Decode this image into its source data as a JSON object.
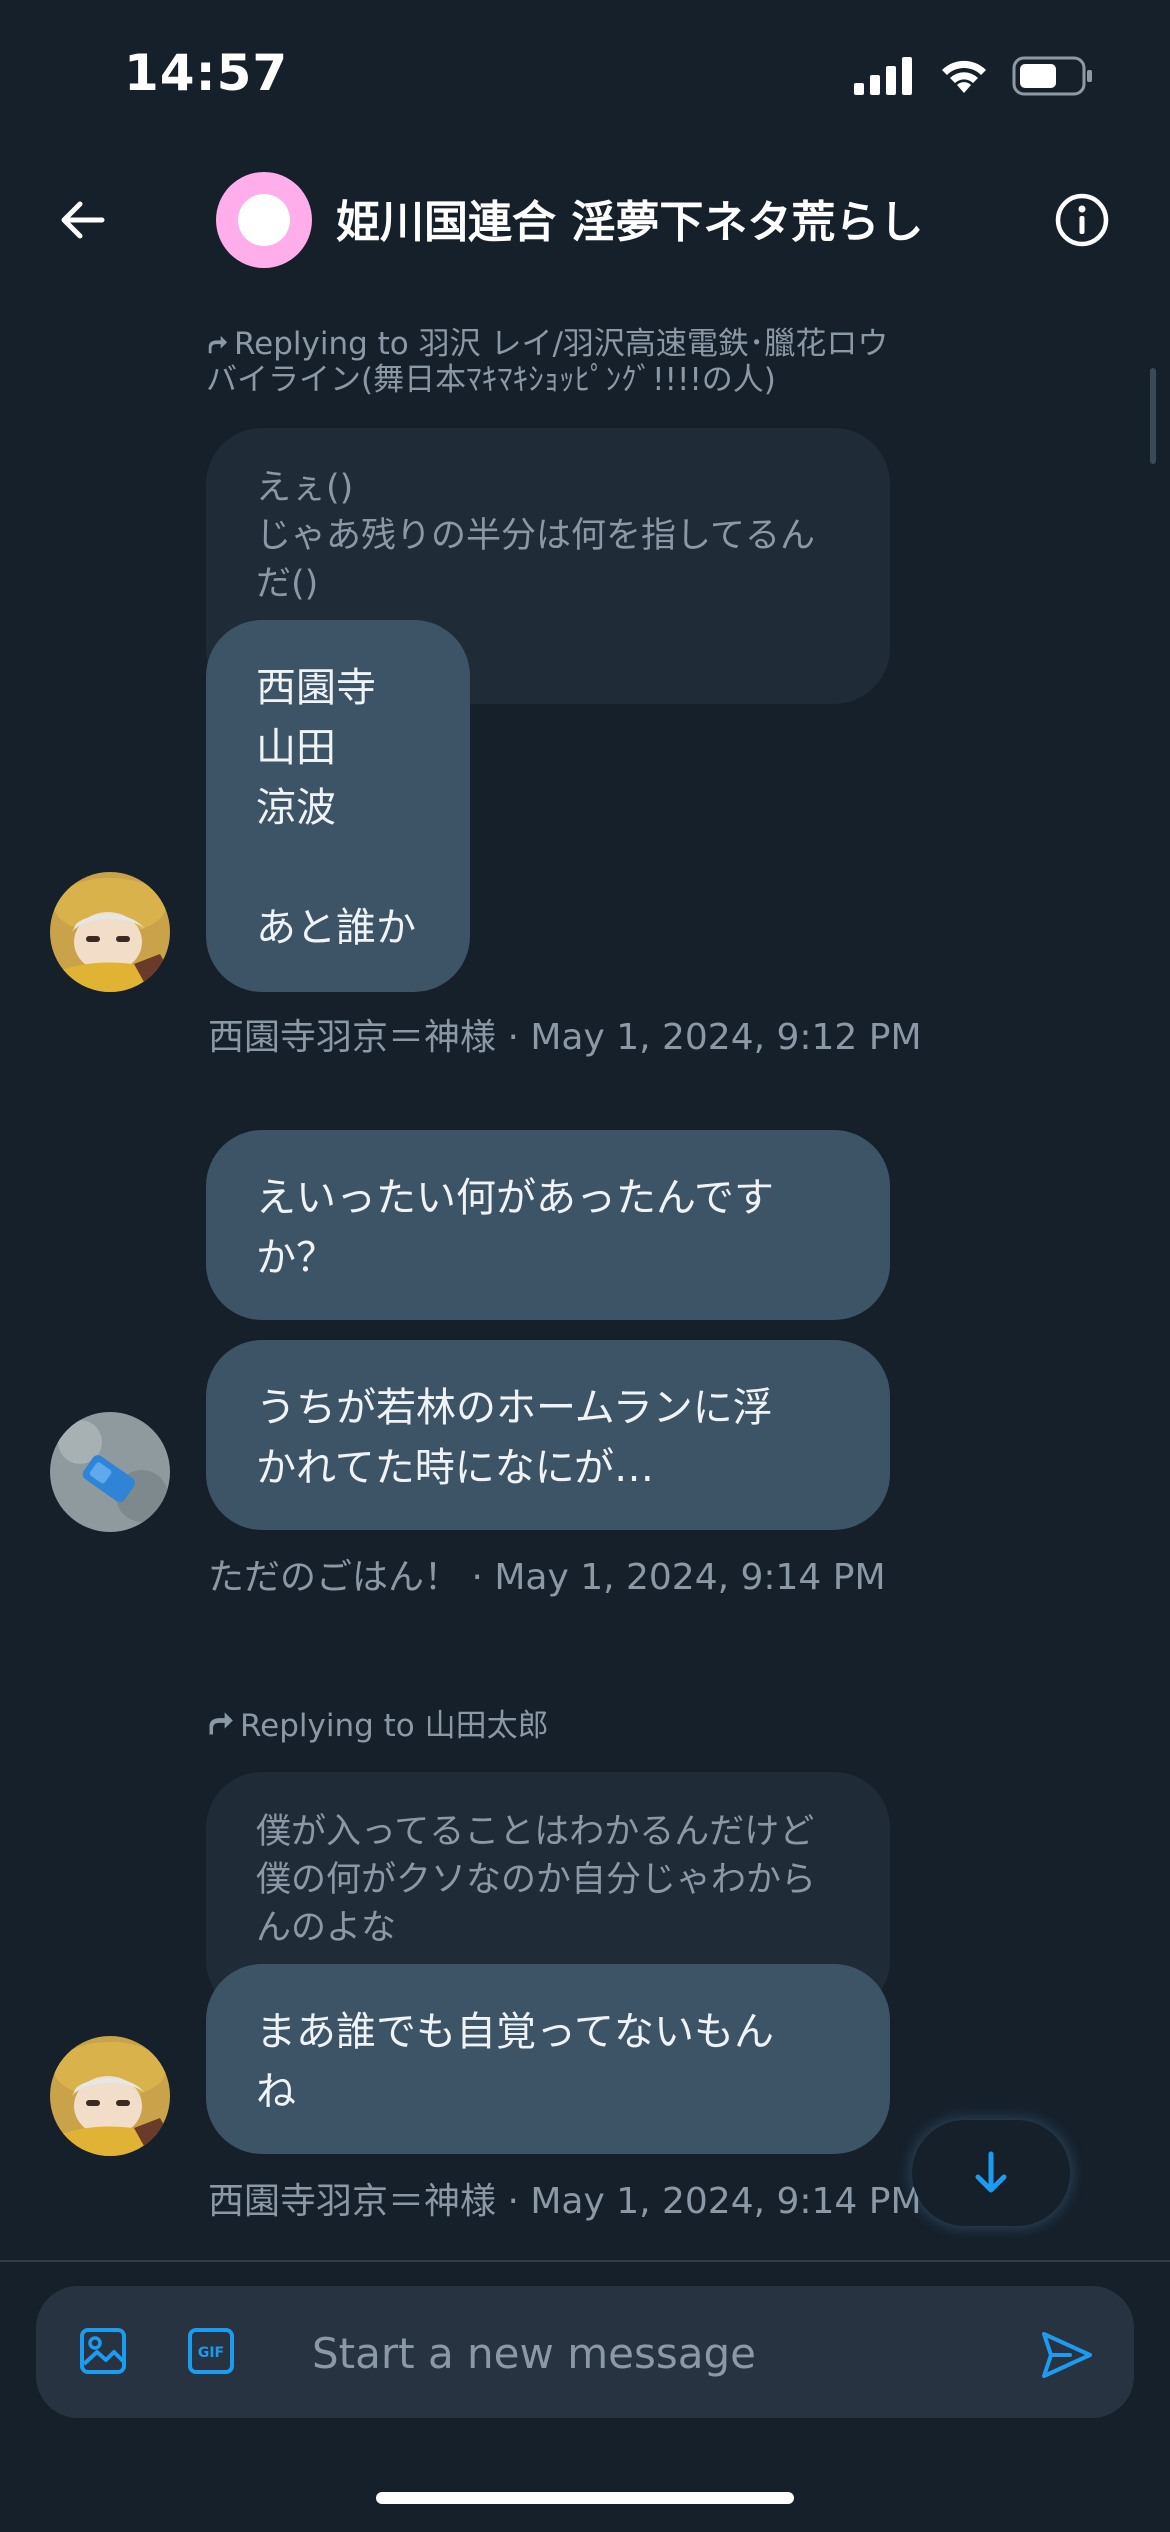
{
  "status_bar": {
    "time": "14:57"
  },
  "header": {
    "title": "姫川国連合 淫夢下ネタ荒らし",
    "icons": {
      "back": "back-arrow-icon",
      "info": "info-icon"
    },
    "avatar_color": "#ffadeb"
  },
  "messages": [
    {
      "reply_to": "Replying to 羽沢 レイ/羽沢高速電鉄･臘花ロウ\nバイライン(舞日本ﾏｷﾏｷｼｮｯﾋﾟﾝｸﾞ!!!!の人)",
      "quoted": "えぇ()\nじゃあ残りの半分は何を指してるん\nだ()",
      "bubbles": [
        "西園寺\n山田\n涼波\n\nあと誰か"
      ],
      "meta": "西園寺羽京＝神様 · May 1, 2024, 9:12 PM"
    },
    {
      "bubbles": [
        "えいったい何があったんです\nか？",
        "うちが若林のホームランに浮\nかれてた時になにが…"
      ],
      "meta": "ただのごはん！ · May 1, 2024, 9:14 PM"
    },
    {
      "reply_to": "Replying to 山田太郎",
      "quoted": "僕が入ってることはわかるんだけど\n僕の何がクソなのか自分じゃわから\nんのよな",
      "bubbles": [
        "まあ誰でも自覚ってないもん\nね"
      ],
      "meta": "西園寺羽京＝神様 · May 1, 2024, 9:14 PM"
    }
  ],
  "composer": {
    "placeholder": "Start a new message",
    "icons": {
      "image": "image-icon",
      "gif": "gif-icon",
      "send": "send-icon"
    },
    "gif_label": "GIF"
  },
  "scroll_down": {
    "icon": "arrow-down-icon"
  },
  "colors": {
    "background": "#15202b",
    "bubble": "#3d5466",
    "quoted": "#202b38",
    "accent": "#1d9bf0",
    "muted_text": "#8b98a5"
  }
}
